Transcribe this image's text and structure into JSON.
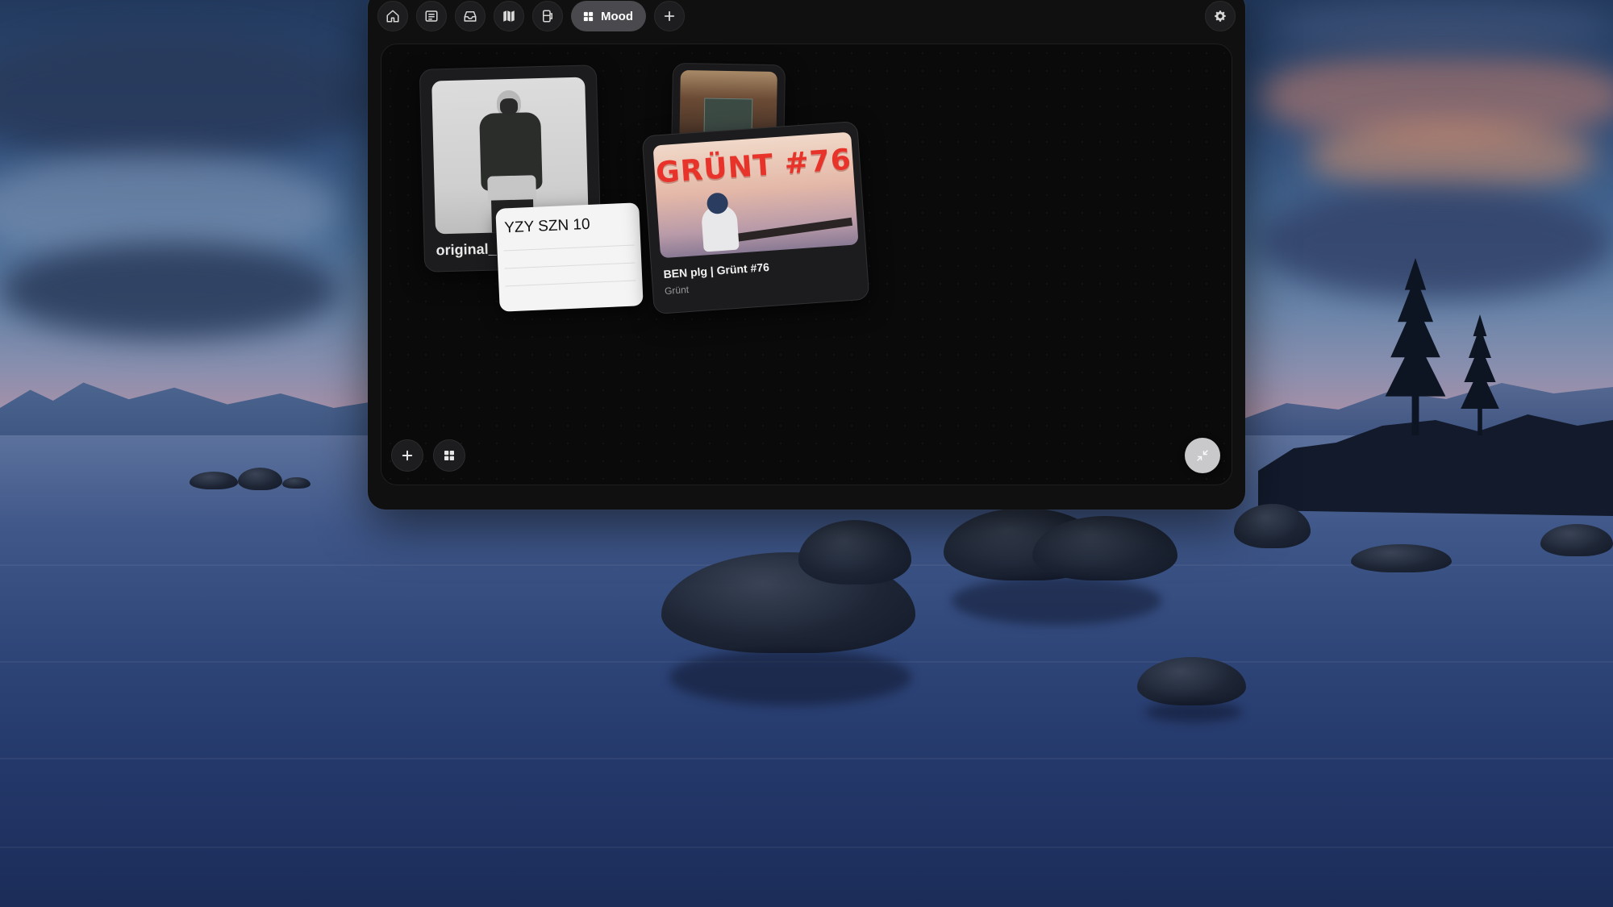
{
  "toolbar": {
    "buttons": [
      {
        "name": "home-button",
        "icon": "home-icon"
      },
      {
        "name": "reader-button",
        "icon": "reader-icon"
      },
      {
        "name": "inbox-button",
        "icon": "inbox-tray-icon"
      },
      {
        "name": "map-button",
        "icon": "map-icon"
      },
      {
        "name": "storage-button",
        "icon": "storage-icon"
      }
    ],
    "active_tab_label": "Mood",
    "active_tab_icon": "grid-icon",
    "add_icon": "plus-icon",
    "settings_icon": "gear-icon"
  },
  "board": {
    "cards": {
      "outfit": {
        "label": "original_"
      },
      "note": {
        "title": "YZY SZN 10"
      },
      "podcast": {
        "art_title": "GRÜNT #76",
        "name": "BEN plg | Grünt #76",
        "show": "Grünt"
      }
    },
    "controls": {
      "add_icon": "plus-icon",
      "layout_icon": "grid-icon",
      "collapse_icon": "collapse-arrows-icon"
    }
  },
  "colors": {
    "window_bg": "#101010",
    "active_pill": "#4a4a4e",
    "podcast_title_red": "#e8332a",
    "collapse_button": "#c9c9cb"
  }
}
